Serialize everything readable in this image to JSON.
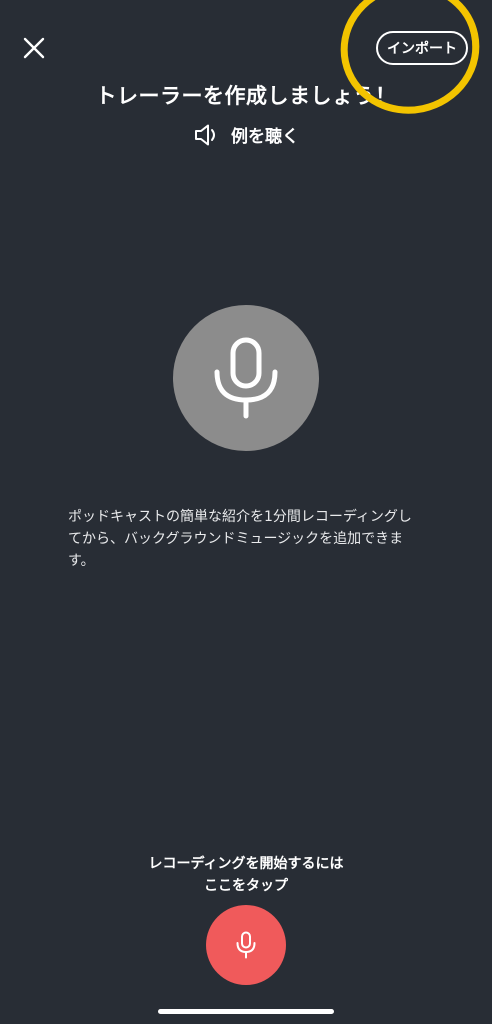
{
  "header": {
    "close_icon": "close-icon",
    "import_label": "インポート",
    "annotation_color": "#f3c400"
  },
  "title": "トレーラーを作成しましょう！",
  "listen": {
    "icon": "speaker-icon",
    "label": "例を聴く"
  },
  "mic_display": {
    "icon": "microphone-icon"
  },
  "description": "ポッドキャストの簡単な紹介を1分間レコーディングしてから、バックグラウンドミュージックを追加できます。",
  "cta": {
    "line1": "レコーディングを開始するには",
    "line2": "ここをタップ"
  },
  "record_button": {
    "icon": "microphone-icon",
    "color": "#f05a5b"
  },
  "colors": {
    "background": "#282d35",
    "mic_circle": "#8c8c8c"
  }
}
